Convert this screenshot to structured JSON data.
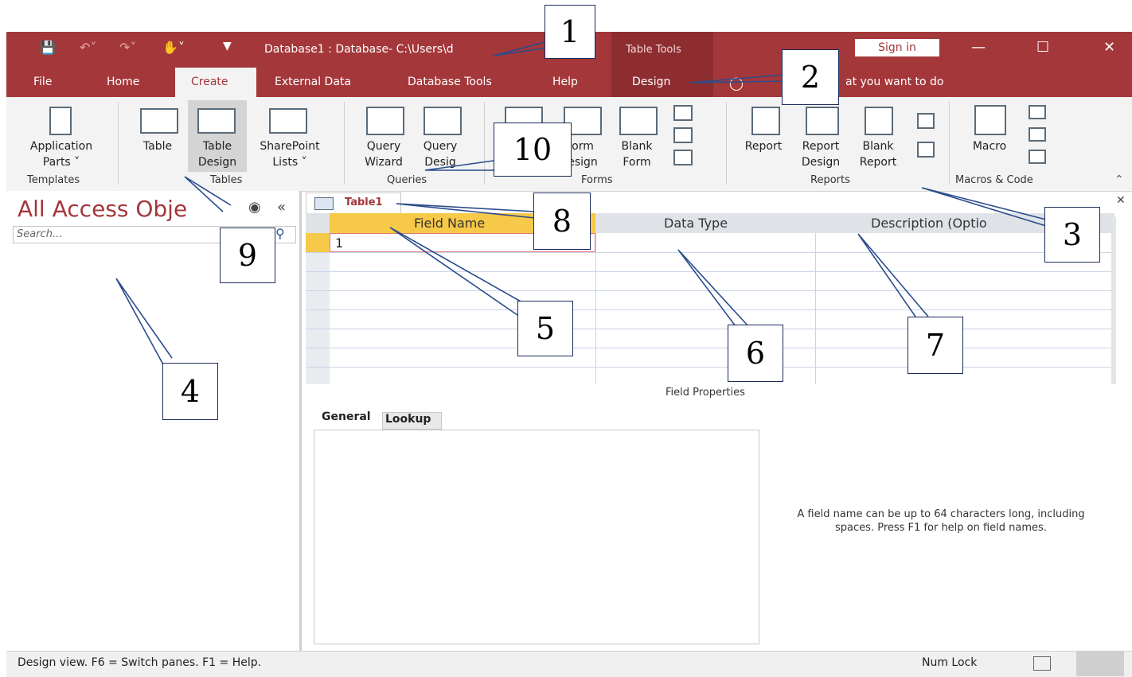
{
  "titlebar": {
    "title": "Database1 : Database- C:\\Users\\d",
    "context_tab": "Table Tools",
    "sign_in": "Sign in"
  },
  "tabs": [
    "File",
    "Home",
    "Create",
    "External Data",
    "Database Tools",
    "Help",
    "Design"
  ],
  "tell_me": "at you want to do",
  "ribbon": {
    "groups": {
      "templates": "Templates",
      "tables": "Tables",
      "queries": "Queries",
      "forms": "Forms",
      "reports": "Reports",
      "macros": "Macros & Code"
    },
    "buttons": {
      "application_parts_1": "Application",
      "application_parts_2": "Parts",
      "table": "Table",
      "table_design_1": "Table",
      "table_design_2": "Design",
      "sharepoint_1": "SharePoint",
      "sharepoint_2": "Lists",
      "query_wizard_1": "Query",
      "query_wizard_2": "Wizard",
      "query_design_1": "Query",
      "query_design_2": "Desig",
      "form_design_1": "orm",
      "form_design_2": "esign",
      "blank_form_1": "Blank",
      "blank_form_2": "Form",
      "report": "Report",
      "report_design_1": "Report",
      "report_design_2": "Design",
      "blank_report_1": "Blank",
      "blank_report_2": "Report",
      "macro": "Macro"
    }
  },
  "nav": {
    "title": "All Access Obje",
    "search_placeholder": "Search..."
  },
  "document": {
    "tab": "Table1",
    "columns": [
      "Field Name",
      "Data Type",
      "Description (Optio"
    ],
    "first_cell": "1"
  },
  "field_properties": {
    "title": "Field Properties",
    "tabs": [
      "General",
      "Lookup"
    ],
    "help": "A field name can be up to 64 characters long, including spaces. Press F1 for help on field names."
  },
  "status": {
    "left": "Design view.  F6 = Switch panes.  F1 = Help.",
    "num_lock": "Num Lock"
  },
  "callouts": [
    "1",
    "2",
    "3",
    "4",
    "5",
    "6",
    "7",
    "8",
    "9",
    "10"
  ],
  "colors": {
    "accent": "#a4373a",
    "context": "#8e2d30",
    "ribbon": "#f3f3f3",
    "active_cell": "#f7c948"
  }
}
